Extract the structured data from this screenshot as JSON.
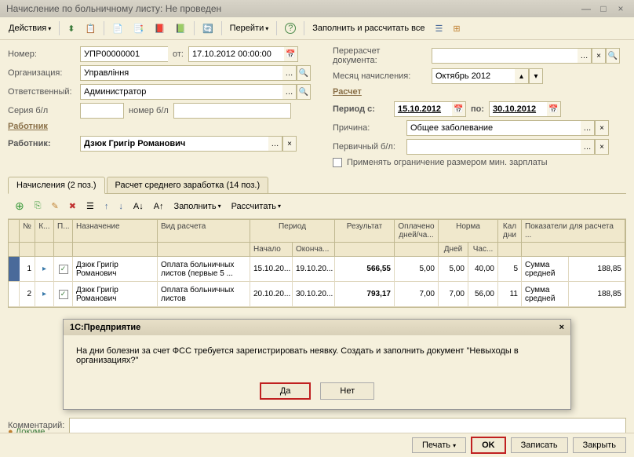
{
  "window": {
    "title": "Начисление по больничному листу: Не проведен"
  },
  "toolbar": {
    "actions": "Действия",
    "goto": "Перейти",
    "fill_calc": "Заполнить и рассчитать все"
  },
  "form": {
    "number_lbl": "Номер:",
    "number": "УПР00000001",
    "from_lbl": "от:",
    "from": "17.10.2012 00:00:00",
    "recalc_lbl": "Перерасчет документа:",
    "recalc": "",
    "org_lbl": "Организация:",
    "org": "Управління",
    "month_lbl": "Месяц начисления:",
    "month": "Октябрь 2012",
    "resp_lbl": "Ответственный:",
    "resp": "Администратор",
    "series_lbl": "Серия б/л",
    "bl_num_lbl": "номер б/л",
    "section_worker": "Работник",
    "worker_lbl": "Работник:",
    "worker": "Дзюк Григір Романович",
    "section_calc": "Расчет",
    "period_lbl": "Период с:",
    "period_from": "15.10.2012",
    "period_to_lbl": "по:",
    "period_to": "30.10.2012",
    "reason_lbl": "Причина:",
    "reason": "Общее заболевание",
    "primary_lbl": "Первичный б/л:",
    "limit_lbl": "Применять ограничение размером мин. зарплаты"
  },
  "tabs": {
    "t1": "Начисления (2 поз.)",
    "t2": "Расчет среднего заработка (14 поз.)"
  },
  "grid_toolbar": {
    "fill": "Заполнить",
    "calc": "Рассчитать"
  },
  "grid": {
    "headers": {
      "n": "№",
      "k": "К...",
      "p": "П...",
      "name": "Назначение",
      "calc_type": "Вид расчета",
      "period": "Период",
      "start": "Начало",
      "end": "Оконча...",
      "result": "Результат",
      "paid": "Оплачено дней/ча...",
      "norm": "Норма",
      "days": "Дней",
      "hours": "Час...",
      "cal": "Кал дни",
      "indicators": "Показатели для расчета ..."
    },
    "rows": [
      {
        "n": "1",
        "name": "Дзюк Григір Романович",
        "calc": "Оплата больничных листов (первые 5 ...",
        "start": "15.10.20...",
        "end": "19.10.20...",
        "result": "566,55",
        "paid": "5,00",
        "days": "5,00",
        "hours": "40,00",
        "cal": "5",
        "ind": "Сумма средней",
        "indv": "188,85"
      },
      {
        "n": "2",
        "name": "Дзюк Григір Романович",
        "calc": "Оплата больничных листов",
        "start": "20.10.20...",
        "end": "30.10.20...",
        "result": "793,17",
        "paid": "7,00",
        "days": "7,00",
        "hours": "56,00",
        "cal": "11",
        "ind": "Сумма средней",
        "indv": "188,85"
      }
    ]
  },
  "dialog": {
    "title": "1С:Предприятие",
    "message": "На дни болезни за счет ФСС требуется зарегистрировать неявку. Создать и заполнить документ \"Невыходы в организациях?\"",
    "yes": "Да",
    "no": "Нет"
  },
  "status": "Докуме",
  "comment_lbl": "Комментарий:",
  "bottom": {
    "print": "Печать",
    "ok": "OK",
    "save": "Записать",
    "close": "Закрыть"
  }
}
